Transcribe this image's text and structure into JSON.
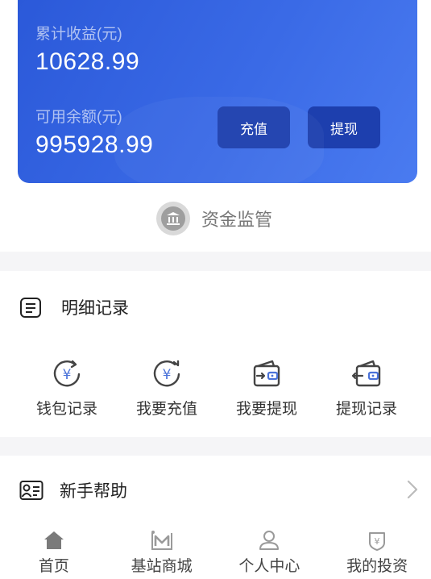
{
  "wallet": {
    "earnings_label": "累计收益(元)",
    "earnings_value": "10628.99",
    "balance_label": "可用余额(元)",
    "balance_value": "995928.99",
    "recharge_label": "充值",
    "withdraw_label": "提现"
  },
  "supervision": {
    "label": "资金监管",
    "icon": "bank-icon"
  },
  "details": {
    "title": "明细记录",
    "items": [
      {
        "label": "钱包记录",
        "icon": "yuan-refresh-icon"
      },
      {
        "label": "我要充值",
        "icon": "yuan-recharge-icon"
      },
      {
        "label": "我要提现",
        "icon": "wallet-out-icon"
      },
      {
        "label": "提现记录",
        "icon": "wallet-in-icon"
      }
    ]
  },
  "help": {
    "title": "新手帮助"
  },
  "tabs": [
    {
      "label": "首页",
      "icon": "home-icon"
    },
    {
      "label": "基站商城",
      "icon": "mall-icon"
    },
    {
      "label": "个人中心",
      "icon": "user-icon"
    },
    {
      "label": "我的投资",
      "icon": "investment-icon"
    }
  ],
  "colors": {
    "card": "#3563e0",
    "card_button": "#1d3fae",
    "icon_blue": "#4a72d9"
  }
}
